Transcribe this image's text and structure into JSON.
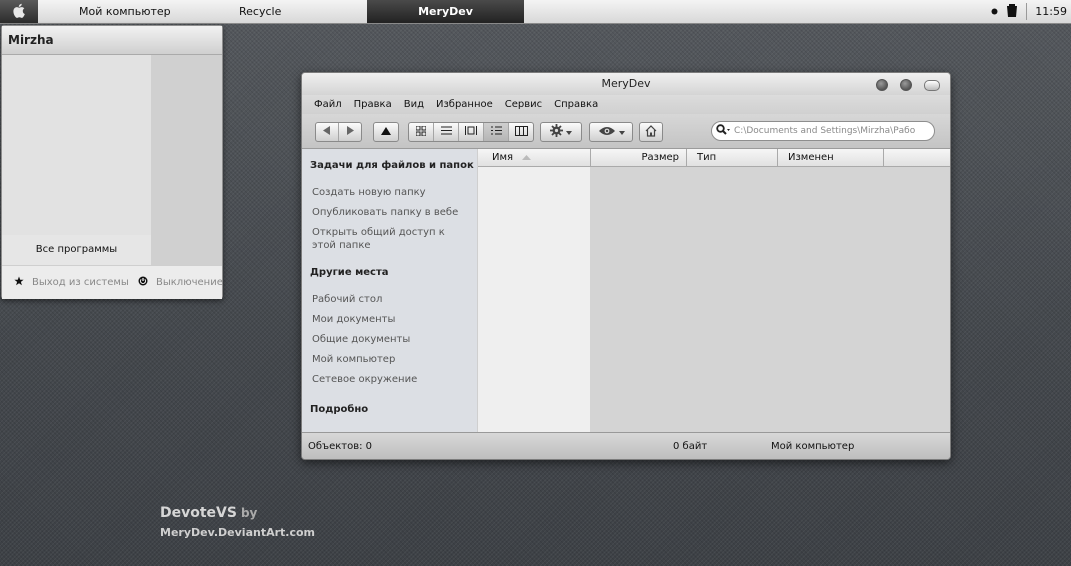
{
  "taskbar": {
    "items": [
      "Мой компьютер",
      "Recycle"
    ],
    "active_window": "MeryDev",
    "clock": "11:59"
  },
  "start_menu": {
    "user": "Mirzha",
    "all_programs": "Все программы",
    "logout": "Выход из системы",
    "shutdown": "Выключение"
  },
  "window": {
    "title": "MeryDev",
    "menu": [
      "Файл",
      "Правка",
      "Вид",
      "Избранное",
      "Сервис",
      "Справка"
    ],
    "address": "C:\\Documents and Settings\\Mirzha\\Рабо",
    "sidebar": {
      "sections": [
        {
          "title": "Задачи для файлов и папок",
          "links": [
            "Создать новую папку",
            "Опубликовать папку в вебе",
            "Открыть общий доступ к этой папке"
          ]
        },
        {
          "title": "Другие места",
          "links": [
            "Рабочий стол",
            "Мои документы",
            "Общие документы",
            "Мой компьютер",
            "Сетевое окружение"
          ]
        },
        {
          "title": "Подробно",
          "links": []
        }
      ]
    },
    "columns": [
      "Имя",
      "Размер",
      "Тип",
      "Изменен"
    ],
    "status": {
      "objects": "Объектов: 0",
      "size": "0 байт",
      "location": "Мой компьютер"
    }
  },
  "watermark": {
    "title": "DevoteVS",
    "by": "by",
    "site": "MeryDev.DeviantArt.com"
  }
}
